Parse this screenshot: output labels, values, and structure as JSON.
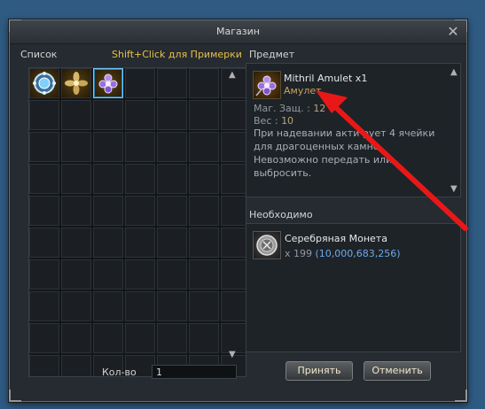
{
  "window": {
    "title": "Магазин",
    "close_symbol": "✕"
  },
  "list": {
    "label": "Список",
    "hint": "Shift+Click для Примерки",
    "items": [
      {
        "icon": "blue-gem-brooch-icon"
      },
      {
        "icon": "gold-flower-charm-icon"
      },
      {
        "icon": "mithril-amulet-icon",
        "selected": true
      }
    ]
  },
  "item_panel": {
    "label": "Предмет",
    "name": "Mithril Amulet x1",
    "type": "Амулет",
    "stats": [
      {
        "label": "Маг. Защ. : ",
        "value": "12"
      },
      {
        "label": "Вес : ",
        "value": "10"
      }
    ],
    "description": [
      "При надевании акти        рует 4 ячейки",
      "для драгоценных камне",
      "Невозможно передать или",
      "выбросить."
    ]
  },
  "required_panel": {
    "label": "Необходимо",
    "name": "Серебряная Монета",
    "amount": "x 199 (10,000,683,256)"
  },
  "quantity": {
    "label": "Кол-во",
    "value": "1"
  },
  "buttons": {
    "accept": "Принять",
    "cancel": "Отменить"
  },
  "colors": {
    "accent_gold": "#e6c04a",
    "item_type": "#c9a25a",
    "amount_blue": "#6ea8e8",
    "selection": "#6ec9ff",
    "arrow_red": "#e81818"
  }
}
